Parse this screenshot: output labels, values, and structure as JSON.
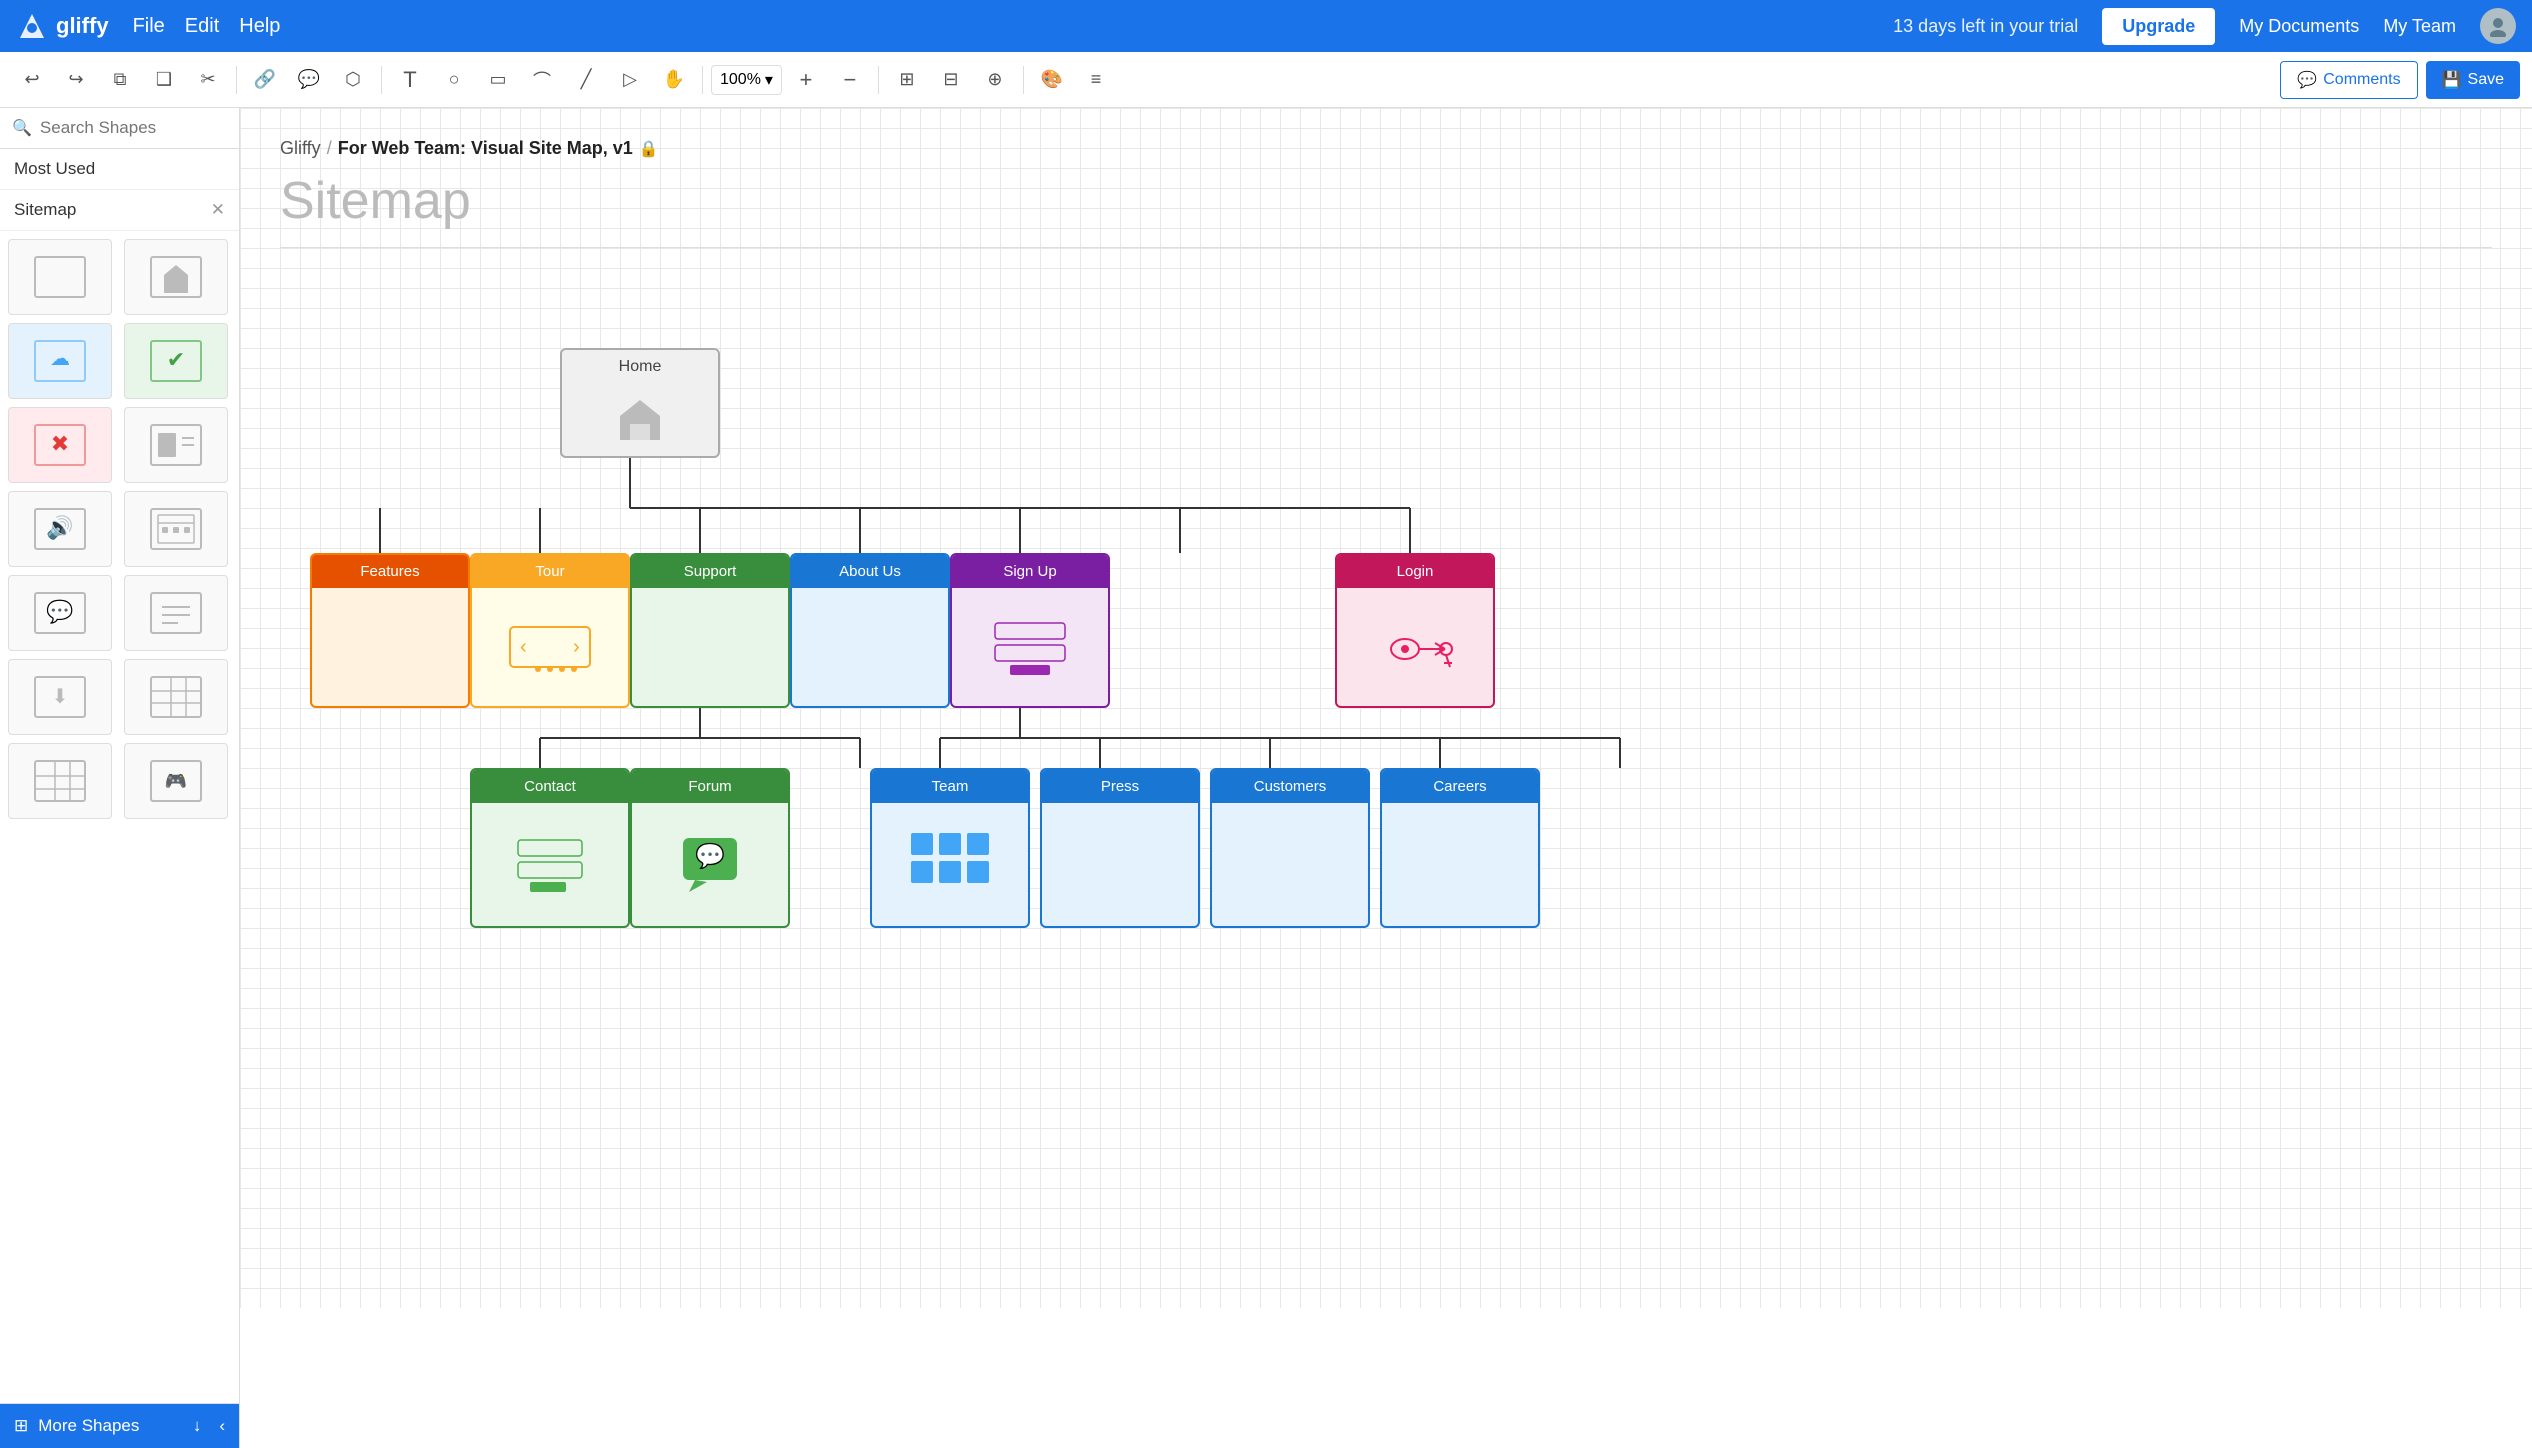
{
  "nav": {
    "logo": "gliffy",
    "links": [
      "File",
      "Edit",
      "Help"
    ],
    "trial_text": "13 days left in your trial",
    "upgrade_label": "Upgrade",
    "my_documents": "My Documents",
    "my_team": "My Team"
  },
  "toolbar": {
    "zoom_level": "100%",
    "comments_label": "Comments",
    "save_label": "Save"
  },
  "sidebar": {
    "search_placeholder": "Search Shapes",
    "most_used_label": "Most Used",
    "sitemap_label": "Sitemap",
    "more_shapes_label": "More Shapes"
  },
  "breadcrumb": {
    "parent": "Gliffy",
    "separator": "/",
    "current": "For Web Team: Visual Site Map, v1"
  },
  "canvas": {
    "title": "Sitemap",
    "nodes": {
      "home": {
        "label": "Home"
      },
      "features": {
        "label": "Features"
      },
      "tour": {
        "label": "Tour"
      },
      "support": {
        "label": "Support"
      },
      "about_us": {
        "label": "About Us"
      },
      "sign_up": {
        "label": "Sign Up"
      },
      "login": {
        "label": "Login"
      },
      "contact": {
        "label": "Contact"
      },
      "forum": {
        "label": "Forum"
      },
      "team": {
        "label": "Team"
      },
      "press": {
        "label": "Press"
      },
      "customers": {
        "label": "Customers"
      },
      "careers": {
        "label": "Careers"
      }
    }
  }
}
